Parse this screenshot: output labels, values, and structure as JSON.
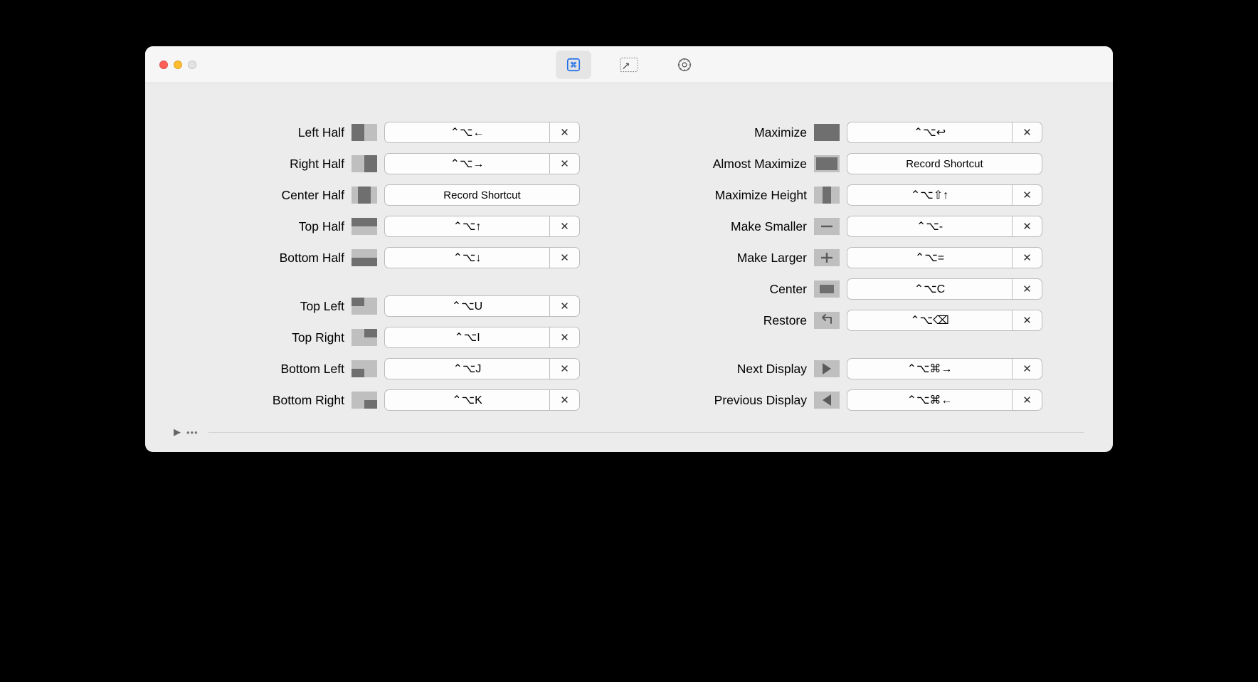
{
  "toolbar": {
    "tabs": [
      "shortcuts",
      "snap-areas",
      "settings"
    ]
  },
  "placeholder": "Record Shortcut",
  "left": {
    "groups": [
      [
        {
          "id": "left-half",
          "label": "Left Half",
          "shortcut": "⌃⌥←",
          "has": true,
          "glyph": "left-half"
        },
        {
          "id": "right-half",
          "label": "Right Half",
          "shortcut": "⌃⌥→",
          "has": true,
          "glyph": "right-half"
        },
        {
          "id": "center-half",
          "label": "Center Half",
          "shortcut": "",
          "has": false,
          "glyph": "center-half"
        },
        {
          "id": "top-half",
          "label": "Top Half",
          "shortcut": "⌃⌥↑",
          "has": true,
          "glyph": "top-half"
        },
        {
          "id": "bottom-half",
          "label": "Bottom Half",
          "shortcut": "⌃⌥↓",
          "has": true,
          "glyph": "bottom-half"
        }
      ],
      [
        {
          "id": "top-left",
          "label": "Top Left",
          "shortcut": "⌃⌥U",
          "has": true,
          "glyph": "top-left"
        },
        {
          "id": "top-right",
          "label": "Top Right",
          "shortcut": "⌃⌥I",
          "has": true,
          "glyph": "top-right"
        },
        {
          "id": "bottom-left",
          "label": "Bottom Left",
          "shortcut": "⌃⌥J",
          "has": true,
          "glyph": "bottom-left"
        },
        {
          "id": "bottom-right",
          "label": "Bottom Right",
          "shortcut": "⌃⌥K",
          "has": true,
          "glyph": "bottom-right"
        }
      ]
    ]
  },
  "right": {
    "groups": [
      [
        {
          "id": "maximize",
          "label": "Maximize",
          "shortcut": "⌃⌥↩",
          "has": true,
          "glyph": "maximize"
        },
        {
          "id": "almost-maximize",
          "label": "Almost Maximize",
          "shortcut": "",
          "has": false,
          "glyph": "almost-maximize"
        },
        {
          "id": "maximize-height",
          "label": "Maximize Height",
          "shortcut": "⌃⌥⇧↑",
          "has": true,
          "glyph": "maximize-height"
        },
        {
          "id": "make-smaller",
          "label": "Make Smaller",
          "shortcut": "⌃⌥-",
          "has": true,
          "glyph": "make-smaller"
        },
        {
          "id": "make-larger",
          "label": "Make Larger",
          "shortcut": "⌃⌥=",
          "has": true,
          "glyph": "make-larger"
        },
        {
          "id": "center",
          "label": "Center",
          "shortcut": "⌃⌥C",
          "has": true,
          "glyph": "center"
        },
        {
          "id": "restore",
          "label": "Restore",
          "shortcut": "⌃⌥⌫",
          "has": true,
          "glyph": "restore"
        }
      ],
      [
        {
          "id": "next-display",
          "label": "Next Display",
          "shortcut": "⌃⌥⌘→",
          "has": true,
          "glyph": "next-display"
        },
        {
          "id": "previous-display",
          "label": "Previous Display",
          "shortcut": "⌃⌥⌘←",
          "has": true,
          "glyph": "previous-display"
        }
      ]
    ]
  }
}
